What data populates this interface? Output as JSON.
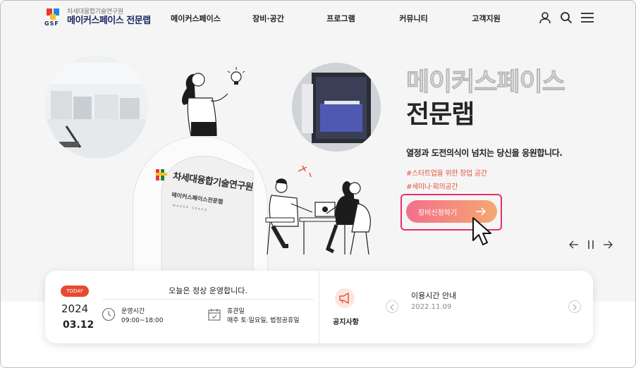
{
  "colors": {
    "accent": "#e5533a",
    "cta_start": "#f2708a",
    "cta_end": "#f5a872",
    "highlight_box": "#e8316b",
    "brand_navy": "#1b2a5e"
  },
  "header": {
    "logo_sub": "차세대융합기술연구원",
    "logo_main": "메이커스페이스 전문랩",
    "logo_letters": "GSF",
    "nav": [
      "메이커스페이스",
      "장비·공간",
      "프로그램",
      "커뮤니티",
      "고객지원"
    ],
    "icons": [
      "user-icon",
      "search-icon",
      "menu-icon"
    ]
  },
  "hero": {
    "title_outline": "메이커스페이스",
    "title_solid": "전문랩",
    "description": "열정과 도전의식이 넘치는 당신을 응원합니다.",
    "hashtags": [
      "#스타트업을 위한 창업 공간",
      "#세미나·회의공간"
    ],
    "cta_label": "장비신청하기",
    "building_sign_title": "차세대융합기술연구원",
    "building_sign_sub": "메이커스페이스전문랩",
    "building_sign_caption": "MAKER SPACE"
  },
  "slider": {
    "prev": "←",
    "pause": "||",
    "next": "→"
  },
  "today": {
    "badge": "TODAY",
    "year": "2024",
    "date": "03.12",
    "status": "오늘은 정상 운영합니다.",
    "hours_label": "운영시간",
    "hours_value": "09:00~18:00",
    "closed_label": "휴관일",
    "closed_value": "매주 토·일요일, 법정공휴일"
  },
  "notice": {
    "label": "공지사항",
    "title": "이용시간 안내",
    "date": "2022.11.09"
  }
}
